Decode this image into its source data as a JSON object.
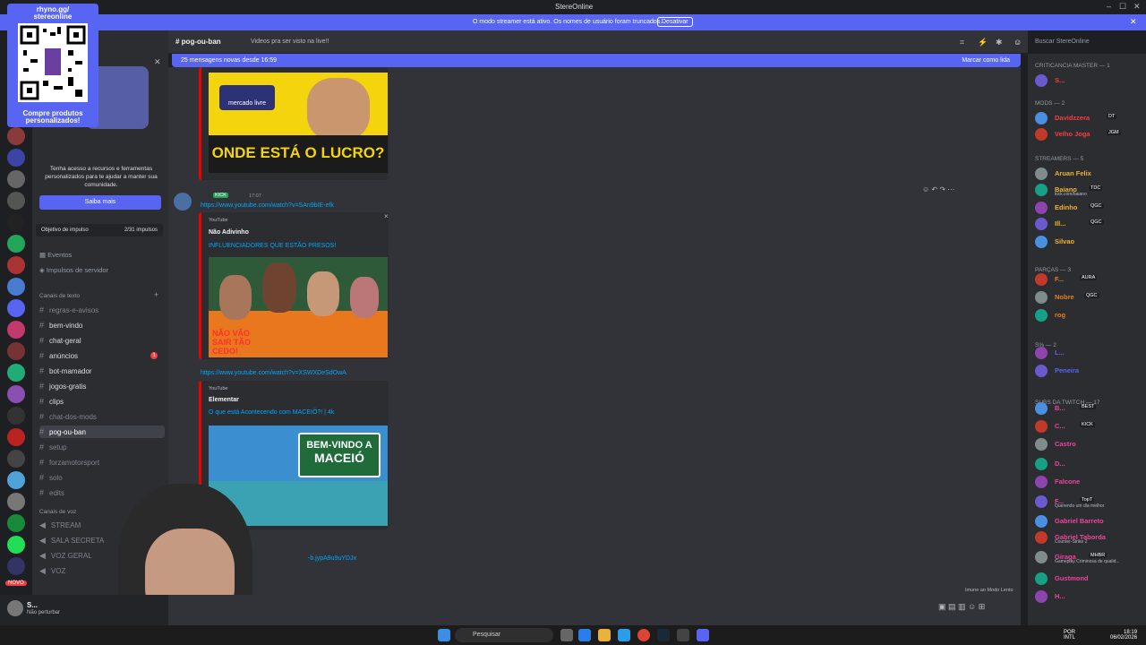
{
  "window": {
    "title": "StereOnline",
    "minimize": "–",
    "maximize": "☐",
    "close": "✕"
  },
  "banner": {
    "message": "O modo streamer está ativo. Os nomes de usuário foram truncados.",
    "button": "Desativar",
    "close": "✕"
  },
  "qr_overlay": {
    "top_text_1": "rhyno.gg/",
    "top_text_2": "stereonline",
    "bottom_text_1": "Compre produtos",
    "bottom_text_2": "personalizados!"
  },
  "sidebar": {
    "boost_notice": "Tenha acesso a recursos e ferramentas personalizados para te ajudar a manter sua comunidade.",
    "saiba_mais": "Saiba mais",
    "objective": {
      "label": "Objetivo de impulso",
      "value": "2/31 impulsos"
    },
    "events": "Eventos",
    "boosts": "Impulsos de servidor",
    "text_category": "Canais de texto",
    "voice_category": "Canais de voz",
    "text_channels": [
      {
        "label": "regras-e-avisos",
        "muted": true
      },
      {
        "label": "bem-vindo",
        "muted": false
      },
      {
        "label": "chat-geral",
        "muted": false
      },
      {
        "label": "anúncios",
        "muted": false,
        "badge": "1"
      },
      {
        "label": "bot-mamador",
        "muted": false
      },
      {
        "label": "jogos-gratis",
        "muted": false
      },
      {
        "label": "clips",
        "muted": false
      },
      {
        "label": "chat-dos-mods",
        "muted": true
      },
      {
        "label": "pog-ou-ban",
        "muted": false,
        "active": true
      },
      {
        "label": "setup",
        "muted": true
      },
      {
        "label": "forzamotorsport",
        "muted": true
      },
      {
        "label": "solo",
        "muted": true
      },
      {
        "label": "edits",
        "muted": true
      }
    ],
    "voice_channels": [
      {
        "label": "STREAM"
      },
      {
        "label": "SALA SECRETA"
      },
      {
        "label": "VOZ GERAL"
      },
      {
        "label": "VOZ"
      }
    ],
    "novo": "NOVO"
  },
  "header": {
    "channel": "pog-ou-ban",
    "topic": "Videos pra ser visto na live!!",
    "search_placeholder": "Buscar StereOnline"
  },
  "new_messages": {
    "text": "25 mensagens novas desde 16:59",
    "action": "Marcar como lida"
  },
  "messages": [
    {
      "embed_thumb_text_1": "mercado livre",
      "embed_thumb_text_2": "ONDE ESTÁ O LUCRO?"
    },
    {
      "time": "17:07",
      "tag": "KICK",
      "link": "https://www.youtube.com/watch?v=SAn9bIE-efk",
      "provider": "YouTube",
      "author": "Não Adivinho",
      "title": "INFLUENCIADORES QUE ESTÃO PRESOS!",
      "thumb_text": "NÃO VÃO SAIR TÃO CEDO!"
    },
    {
      "link": "https://www.youtube.com/watch?v=XSWXDeSdOwA",
      "provider": "YouTube",
      "author": "Elementar",
      "title": "O que está Acontecendo com MACEIÓ?! | 4k",
      "thumb_text_1": "BEM-VINDO A",
      "thumb_text_2": "MACEIÓ"
    },
    {
      "link_tail": "-b.jypA9u9uYDJx"
    }
  ],
  "members": {
    "categories": [
      {
        "label": "CRITICANCIA MASTER — 1"
      },
      {
        "label": "MODS — 2"
      },
      {
        "label": "STREAMERS — 5"
      },
      {
        "label": "PARÇAS — 3"
      },
      {
        "label": "S% — 2"
      },
      {
        "label": "SUBS DA TWITCH — 17"
      }
    ],
    "list": [
      {
        "name": "S...",
        "color": "#f23f43"
      },
      {
        "name": "Davidzzera",
        "color": "#f23f43",
        "tag": "DT"
      },
      {
        "name": "Velho Joga",
        "color": "#f23f43",
        "tag": "JGM"
      },
      {
        "name": "Aruan Felix",
        "color": "#f0b232"
      },
      {
        "name": "Baiano",
        "color": "#f0b232",
        "tag": "TDC",
        "sub": "kick.com/baiano"
      },
      {
        "name": "Edinho",
        "color": "#f0b232",
        "tag": "QGC"
      },
      {
        "name": "Ill...",
        "color": "#f0b232",
        "tag": "QGC"
      },
      {
        "name": "Silvao",
        "color": "#f0b232"
      },
      {
        "name": "F...",
        "color": "#e67e22",
        "tag": "AURA"
      },
      {
        "name": "Nobre",
        "color": "#e67e22",
        "tag": "QGC"
      },
      {
        "name": "rog",
        "color": "#e67e22"
      },
      {
        "name": "L...",
        "color": "#5865f2"
      },
      {
        "name": "Peneira",
        "color": "#5865f2"
      },
      {
        "name": "B...",
        "color": "#eb459e",
        "tag": "BEST"
      },
      {
        "name": "C...",
        "color": "#eb459e",
        "tag": "KICK"
      },
      {
        "name": "Castro",
        "color": "#eb459e"
      },
      {
        "name": "D...",
        "color": "#eb459e"
      },
      {
        "name": "Falcone",
        "color": "#eb459e"
      },
      {
        "name": "F...",
        "color": "#eb459e",
        "tag": "TopT",
        "sub": "Querendo um dia melhor"
      },
      {
        "name": "Gabriel Barreto",
        "color": "#eb459e"
      },
      {
        "name": "Gabriel Taborda",
        "color": "#eb459e",
        "sub": "Counter-Strike 2"
      },
      {
        "name": "Giraga",
        "color": "#eb459e",
        "tag": "MHBR",
        "sub": "Gameplay Criminosa de qualid..."
      },
      {
        "name": "Gustmond",
        "color": "#eb459e"
      },
      {
        "name": "H...",
        "color": "#eb459e"
      }
    ]
  },
  "user": {
    "name": "S...",
    "status": "Não perturbar"
  },
  "composer": {
    "slow_mode": "Imune ao Modo Lento"
  },
  "taskbar": {
    "search": "Pesquisar",
    "lang_1": "POR",
    "lang_2": "INTL",
    "time": "18:19",
    "date": "06/02/2026"
  },
  "colors": {
    "blurple": "#5865f2",
    "bg": "#313338",
    "sidebar": "#2b2d31",
    "dark": "#1e1f22"
  }
}
